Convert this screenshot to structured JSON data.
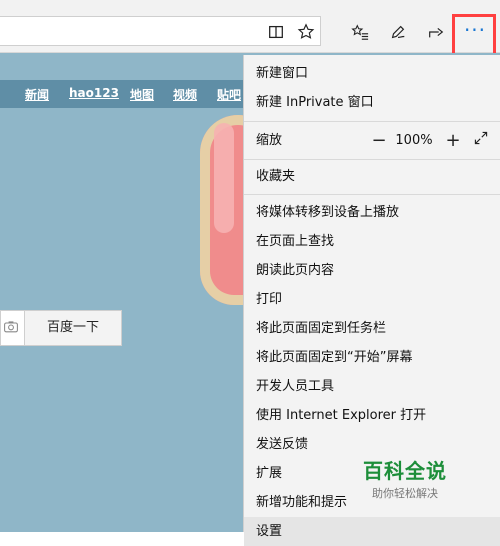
{
  "toolbar": {
    "icons": [
      "reading-view-icon",
      "favorite-star-icon",
      "favorites-list-icon",
      "pen-icon",
      "share-icon",
      "more-icon"
    ],
    "more_label": "···",
    "accent_color": "#1976d2",
    "highlight_color": "#ff4040"
  },
  "page": {
    "nav_links": [
      "新闻",
      "hao123",
      "地图",
      "视频",
      "贴吧"
    ],
    "search_button": "百度一下"
  },
  "menu": {
    "items": {
      "new_window": "新建窗口",
      "new_inprivate": "新建 InPrivate 窗口",
      "zoom_label": "缩放",
      "zoom_value": "100%",
      "favorites": "收藏夹",
      "cast_media": "将媒体转移到设备上播放",
      "find_on_page": "在页面上查找",
      "read_aloud": "朗读此页内容",
      "print": "打印",
      "pin_taskbar": "将此页面固定到任务栏",
      "pin_start": "将此页面固定到“开始”屏幕",
      "dev_tools": "开发人员工具",
      "open_ie": "使用 Internet Explorer 打开",
      "feedback": "发送反馈",
      "extensions": "扩展",
      "whats_new": "新增功能和提示",
      "settings": "设置"
    }
  },
  "watermark": {
    "main": "百科全说",
    "sub": "助你轻松解决"
  }
}
